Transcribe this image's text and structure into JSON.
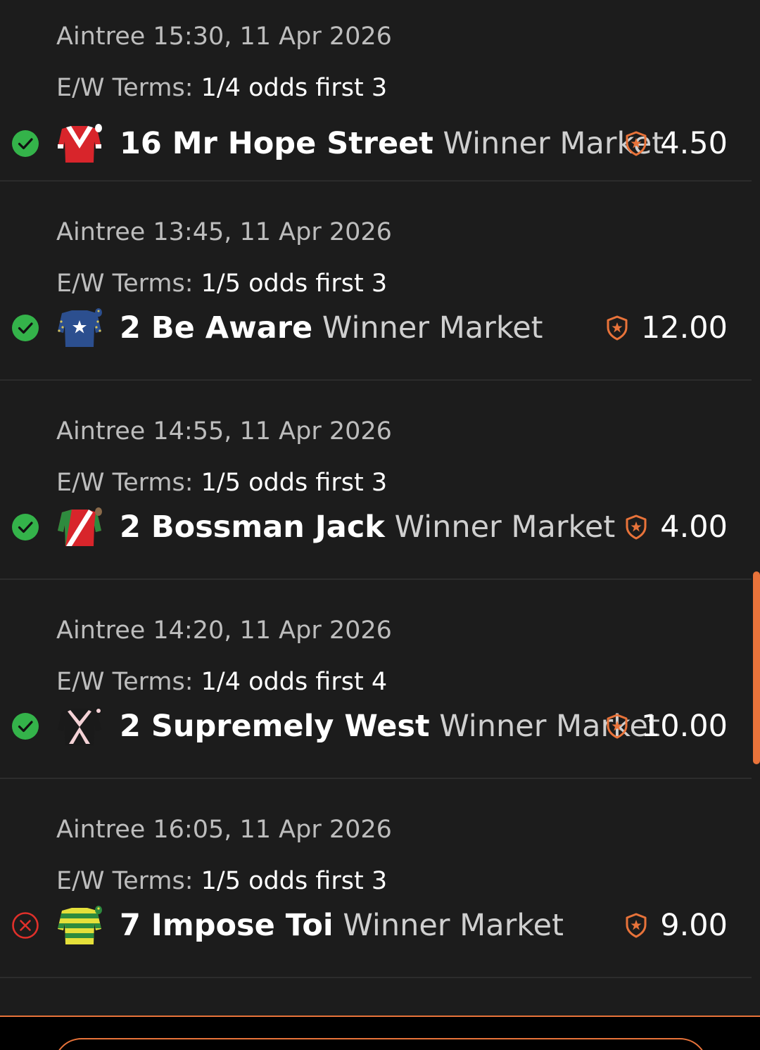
{
  "colors": {
    "background": "#1c1c1c",
    "accent": "#e8733a",
    "win_green": "#34b34a",
    "loss_red": "#e0302a"
  },
  "terms_label": "E/W Terms:",
  "selections": [
    {
      "event": "Aintree 15:30, 11 Apr 2026",
      "terms_value": "1/4 odds first 3",
      "status": "won",
      "status_icon": "check-circle-icon",
      "silk": "red-white-chevron-silk",
      "runner": "16 Mr Hope Street",
      "market": "Winner Market",
      "odds": "4.50"
    },
    {
      "event": "Aintree 13:45, 11 Apr 2026",
      "terms_value": "1/5 odds first 3",
      "status": "won",
      "status_icon": "check-circle-icon",
      "silk": "navy-star-silk",
      "runner": "2 Be Aware",
      "market": "Winner Market",
      "odds": "12.00"
    },
    {
      "event": "Aintree 14:55, 11 Apr 2026",
      "terms_value": "1/5 odds first 3",
      "status": "won",
      "status_icon": "check-circle-icon",
      "silk": "red-green-sash-silk",
      "runner": "2 Bossman Jack",
      "market": "Winner Market",
      "odds": "4.00"
    },
    {
      "event": "Aintree 14:20, 11 Apr 2026",
      "terms_value": "1/4 odds first 4",
      "status": "won",
      "status_icon": "check-circle-icon",
      "silk": "black-white-cross-silk",
      "runner": "2 Supremely West",
      "market": "Winner Market",
      "odds": "10.00"
    },
    {
      "event": "Aintree 16:05, 11 Apr 2026",
      "terms_value": "1/5 odds first 3",
      "status": "lost",
      "status_icon": "x-circle-icon",
      "silk": "yellow-green-hoops-silk",
      "runner": "7 Impose Toi",
      "market": "Winner Market",
      "odds": "9.00"
    }
  ]
}
